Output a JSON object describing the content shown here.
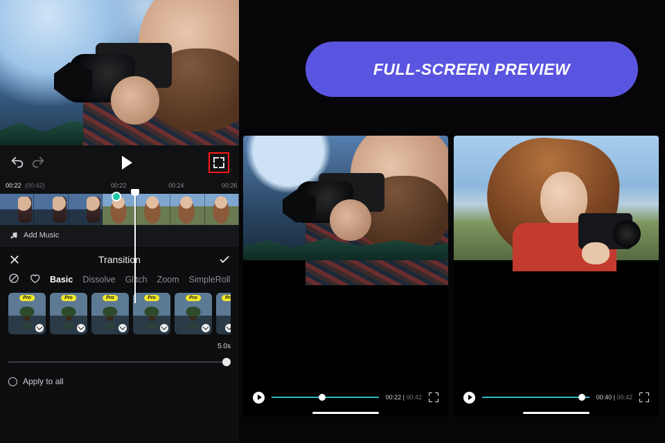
{
  "editor": {
    "timecodes": {
      "current": "00:22",
      "duration_hint": "(00:42)",
      "t2": "00:22",
      "t3": "00:24",
      "t4": "00:26"
    },
    "music_label": "Add Music"
  },
  "panel": {
    "title": "Transition",
    "tabs": [
      "Basic",
      "Dissolve",
      "Glitch",
      "Zoom",
      "SimpleRoll"
    ],
    "active_tab": "Basic",
    "pro_badge": "Pro",
    "duration_label": "5.0s",
    "apply_all_label": "Apply to all"
  },
  "banner": {
    "text": "FULL-SCREEN PREVIEW"
  },
  "preview_a": {
    "current": "00:22",
    "duration": "00:42",
    "progress": 0.52
  },
  "preview_b": {
    "current": "00:40",
    "duration": "00:42",
    "progress": 0.95
  }
}
